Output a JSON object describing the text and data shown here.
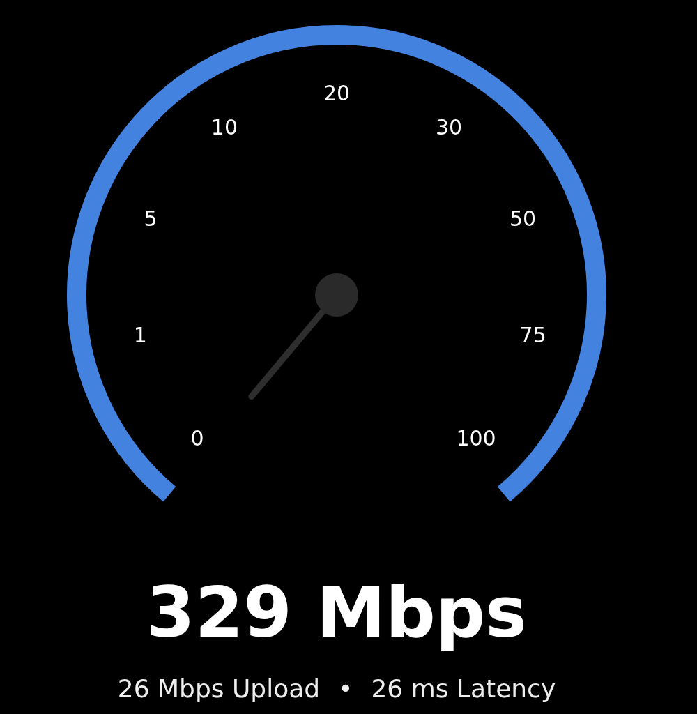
{
  "gauge": {
    "scale_labels": [
      "0",
      "1",
      "5",
      "10",
      "20",
      "30",
      "50",
      "75",
      "100"
    ]
  },
  "speed": {
    "value": "329 Mbps"
  },
  "details": {
    "upload": "26 Mbps Upload",
    "separator": "•",
    "latency": "26 ms Latency"
  }
}
